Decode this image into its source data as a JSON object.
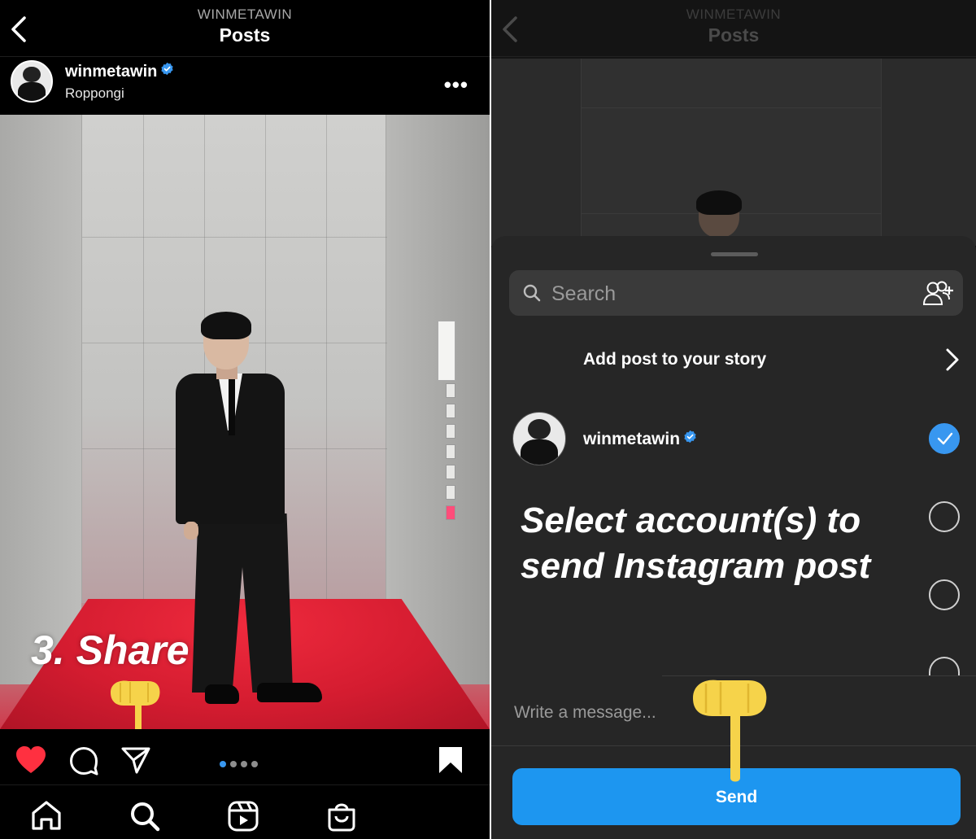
{
  "left": {
    "header": {
      "subtitle": "WINMETAWIN",
      "title": "Posts"
    },
    "post": {
      "username": "winmetawin",
      "location": "Roppongi",
      "more": "•••"
    },
    "annotation": "3. Share",
    "carousel": {
      "count": 4,
      "active_index": 0
    }
  },
  "right": {
    "header": {
      "subtitle": "WINMETAWIN",
      "title": "Posts"
    },
    "search": {
      "placeholder": "Search"
    },
    "story": {
      "label": "Add post to your story"
    },
    "account": {
      "username": "winmetawin",
      "selected": true
    },
    "annotation": "Select account(s) to send Instagram post",
    "message": {
      "placeholder": "Write a message..."
    },
    "send_label": "Send"
  },
  "colors": {
    "accent": "#3897f0",
    "send_button": "#1d96f0",
    "like_red": "#ff3040",
    "pointer_yellow": "#f6d34a"
  },
  "icons": [
    "back-icon",
    "verified-icon",
    "more-icon",
    "heart-icon",
    "comment-icon",
    "share-icon",
    "bookmark-icon",
    "home-icon",
    "search-icon",
    "reels-icon",
    "shop-icon",
    "add-people-icon",
    "chevron-right-icon",
    "check-icon",
    "pointing-finger-icon"
  ]
}
